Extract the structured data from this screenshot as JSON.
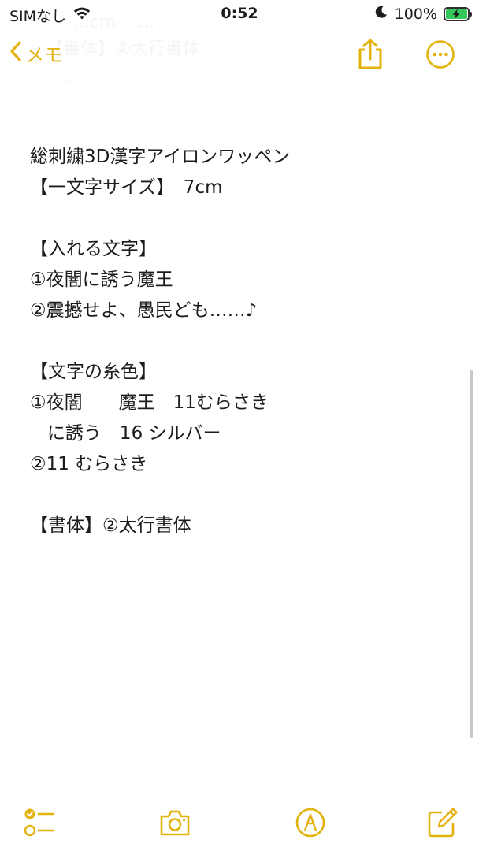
{
  "status_bar": {
    "carrier": "SIMなし",
    "time": "0:52",
    "battery_percent": "100%"
  },
  "nav": {
    "back_label": "メモ"
  },
  "ghost_text": "     ...cm    ...\n【書体】②太行書体\n  ...",
  "note": {
    "lines": [
      "総刺繍3D漢字アイロンワッペン",
      "【一文字サイズ】　7cm",
      "",
      "【入れる文字】",
      "①夜闇に誘う魔王",
      "②震撼せよ、愚民ども……♪",
      "",
      "【文字の糸色】",
      "①夜闇　　魔王　11むらさき",
      "   に誘う　16 シルバー",
      "②11 むらさき",
      "",
      "【書体】②太行書体"
    ]
  },
  "colors": {
    "accent": "#e4b20d",
    "battery": "#34c759",
    "text": "#1c1c1e"
  },
  "icons": {
    "wifi": "wifi-icon",
    "moon": "moon-icon",
    "battery": "battery-charging-icon",
    "back": "chevron-left-icon",
    "share": "share-icon",
    "more": "ellipsis-circle-icon",
    "checklist": "checklist-icon",
    "camera": "camera-icon",
    "markup": "markup-pen-icon",
    "compose": "compose-icon"
  }
}
